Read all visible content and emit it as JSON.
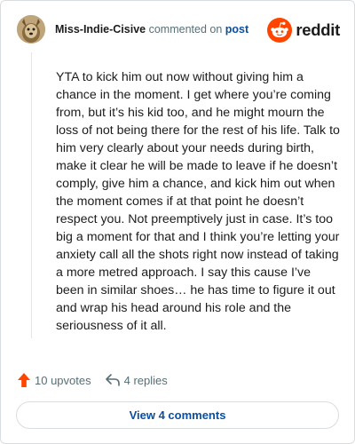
{
  "comment": {
    "username": "Miss-Indie-Cisive",
    "commented_on_text": "commented on",
    "post_link_label": "post",
    "body": "YTA to kick him out now without giving him a chance in the moment. I get where you’re coming from, but it’s his kid too, and he might mourn the loss of not being there for the rest of his life. Talk to him very clearly about your needs during birth, make it clear he will be made to leave if he doesn’t comply, give him a chance, and kick him out when the moment comes if at that point he doesn’t respect you. Not preemptively just in case. It’s too big a moment for that and I think you’re letting your anxiety call all the shots right now instead of taking a more metred approach. I say this cause I’ve been in similar shoes… he has time to figure it out and wrap his head around his role and the seriousness of it all.",
    "upvotes_label": "10 upvotes",
    "replies_label": "4 replies"
  },
  "brand": {
    "wordmark": "reddit",
    "icon": "reddit-snoo-icon",
    "color": "#ff4500"
  },
  "footer": {
    "view_comments_label": "View 4 comments"
  },
  "colors": {
    "accent": "#ff4500",
    "link": "#0a4fa0",
    "muted": "#576f76"
  }
}
